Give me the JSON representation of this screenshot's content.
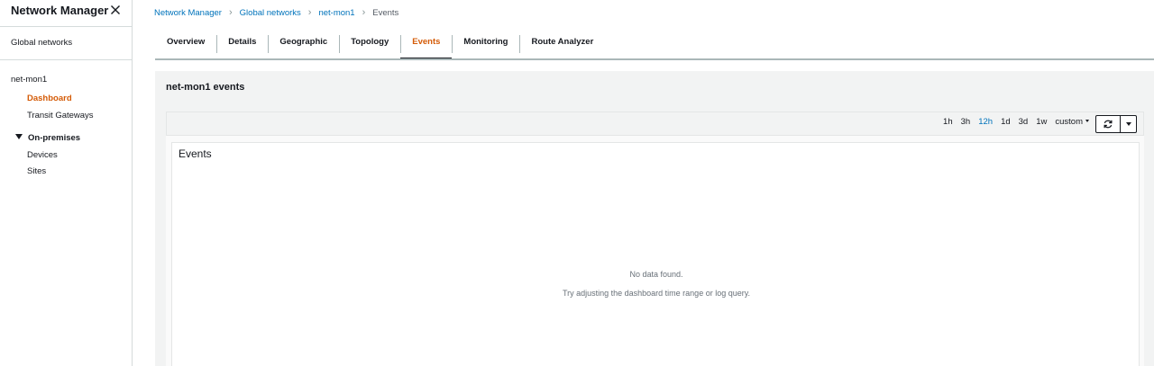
{
  "sidebar": {
    "title": "Network Manager",
    "global_networks": "Global networks",
    "section_title": "net-mon1",
    "links": [
      "Dashboard",
      "Transit Gateways"
    ],
    "group_title": "On-premises",
    "group_links": [
      "Devices",
      "Sites"
    ]
  },
  "breadcrumb": {
    "items": [
      "Network Manager",
      "Global networks",
      "net-mon1"
    ],
    "current": "Events"
  },
  "tabs": [
    "Overview",
    "Details",
    "Geographic",
    "Topology",
    "Events",
    "Monitoring",
    "Route Analyzer"
  ],
  "active_tab": "Events",
  "panel": {
    "title": "net-mon1 events"
  },
  "toolbar": {
    "time_options": [
      "1h",
      "3h",
      "12h",
      "1d",
      "3d",
      "1w"
    ],
    "active_time": "12h",
    "custom_label": "custom"
  },
  "widget": {
    "title": "Events",
    "empty_message": "No data found.",
    "empty_hint": "Try adjusting the dashboard time range or log query."
  },
  "colors": {
    "accent_orange": "#d45b07",
    "link_blue": "#0073bb",
    "text_dark": "#16191f",
    "muted_text": "#687078",
    "panel_bg": "#f2f3f3"
  },
  "icons": {
    "close": "close-icon",
    "caret": "caret-down-icon",
    "refresh": "refresh-icon",
    "chevron": "chevron-right-icon"
  }
}
